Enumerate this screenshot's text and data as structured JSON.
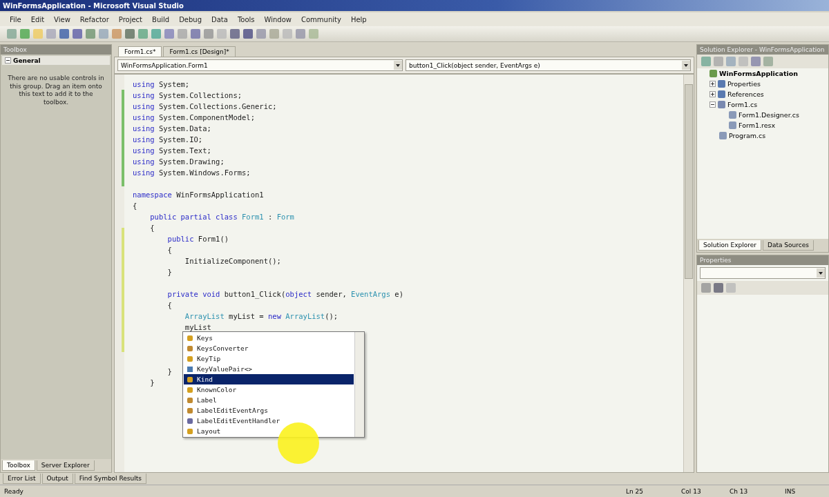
{
  "window": {
    "title": "WinFormsApplication - Microsoft Visual Studio"
  },
  "menu": [
    "File",
    "Edit",
    "View",
    "Refactor",
    "Project",
    "Build",
    "Debug",
    "Data",
    "Tools",
    "Window",
    "Community",
    "Help"
  ],
  "toolbox": {
    "title": "Toolbox",
    "group": "General",
    "message": "There are no usable controls in this group. Drag an item onto this text to add it to the toolbox.",
    "tabs": [
      {
        "label": "Toolbox",
        "selected": true
      },
      {
        "label": "Server Explorer",
        "selected": false
      }
    ]
  },
  "editor": {
    "tabs": [
      {
        "label": "Form1.cs*",
        "selected": true
      },
      {
        "label": "Form1.cs [Design]*",
        "selected": false
      }
    ],
    "type_dropdown": "WinFormsApplication.Form1",
    "member_dropdown": "button1_Click(object sender, EventArgs e)",
    "code_lines": [
      {
        "kind": "code",
        "tokens": [
          {
            "text": "using",
            "kind": "keyword"
          },
          {
            "text": " System;",
            "kind": "plain"
          }
        ]
      },
      {
        "kind": "code",
        "tokens": [
          {
            "text": "using",
            "kind": "keyword"
          },
          {
            "text": " System.Collections;",
            "kind": "plain"
          }
        ]
      },
      {
        "kind": "code",
        "tokens": [
          {
            "text": "using",
            "kind": "keyword"
          },
          {
            "text": " System.Collections.Generic;",
            "kind": "plain"
          }
        ]
      },
      {
        "kind": "code",
        "tokens": [
          {
            "text": "using",
            "kind": "keyword"
          },
          {
            "text": " System.ComponentModel;",
            "kind": "plain"
          }
        ]
      },
      {
        "kind": "code",
        "tokens": [
          {
            "text": "using",
            "kind": "keyword"
          },
          {
            "text": " System.Data;",
            "kind": "plain"
          }
        ]
      },
      {
        "kind": "code",
        "tokens": [
          {
            "text": "using",
            "kind": "keyword"
          },
          {
            "text": " System.IO;",
            "kind": "plain"
          }
        ]
      },
      {
        "kind": "code",
        "tokens": [
          {
            "text": "using",
            "kind": "keyword"
          },
          {
            "text": " System.Text;",
            "kind": "plain"
          }
        ]
      },
      {
        "kind": "code",
        "tokens": [
          {
            "text": "using",
            "kind": "keyword"
          },
          {
            "text": " System.Drawing;",
            "kind": "plain"
          }
        ]
      },
      {
        "kind": "code",
        "tokens": [
          {
            "text": "using",
            "kind": "keyword"
          },
          {
            "text": " System.Windows.Forms;",
            "kind": "plain"
          }
        ]
      },
      {
        "kind": "blank"
      },
      {
        "kind": "code",
        "tokens": [
          {
            "text": "namespace",
            "kind": "keyword"
          },
          {
            "text": " WinFormsApplication1",
            "kind": "plain"
          }
        ]
      },
      {
        "kind": "code",
        "tokens": [
          {
            "text": "{",
            "kind": "plain"
          }
        ]
      },
      {
        "kind": "code",
        "tokens": [
          {
            "text": "    public partial class",
            "kind": "keyword"
          },
          {
            "text": " Form1",
            "kind": "type"
          },
          {
            "text": " : ",
            "kind": "plain"
          },
          {
            "text": "Form",
            "kind": "type"
          }
        ]
      },
      {
        "kind": "code",
        "tokens": [
          {
            "text": "    {",
            "kind": "plain"
          }
        ]
      },
      {
        "kind": "code",
        "tokens": [
          {
            "text": "        public",
            "kind": "keyword"
          },
          {
            "text": " Form1()",
            "kind": "plain"
          }
        ]
      },
      {
        "kind": "code",
        "tokens": [
          {
            "text": "        {",
            "kind": "plain"
          }
        ]
      },
      {
        "kind": "code",
        "tokens": [
          {
            "text": "            InitializeComponent();",
            "kind": "plain"
          }
        ]
      },
      {
        "kind": "code",
        "tokens": [
          {
            "text": "        }",
            "kind": "plain"
          }
        ]
      },
      {
        "kind": "blank"
      },
      {
        "kind": "code",
        "tokens": [
          {
            "text": "        private void",
            "kind": "keyword"
          },
          {
            "text": " button1_Click(",
            "kind": "plain"
          },
          {
            "text": "object",
            "kind": "keyword"
          },
          {
            "text": " sender, ",
            "kind": "plain"
          },
          {
            "text": "EventArgs",
            "kind": "type"
          },
          {
            "text": " e)",
            "kind": "plain"
          }
        ]
      },
      {
        "kind": "code",
        "tokens": [
          {
            "text": "        {",
            "kind": "plain"
          }
        ]
      },
      {
        "kind": "code",
        "tokens": [
          {
            "text": "            ArrayList",
            "kind": "type"
          },
          {
            "text": " myList = ",
            "kind": "plain"
          },
          {
            "text": "new",
            "kind": "keyword"
          },
          {
            "text": " ArrayList",
            "kind": "type"
          },
          {
            "text": "();",
            "kind": "plain"
          }
        ]
      },
      {
        "kind": "code",
        "tokens": [
          {
            "text": "            myList",
            "kind": "plain"
          }
        ]
      },
      {
        "kind": "blank"
      },
      {
        "kind": "blank"
      },
      {
        "kind": "blank"
      },
      {
        "kind": "code",
        "tokens": [
          {
            "text": "        }",
            "kind": "plain"
          }
        ]
      },
      {
        "kind": "code",
        "tokens": [
          {
            "text": "    }",
            "kind": "plain"
          }
        ]
      }
    ],
    "completion": [
      {
        "label": "Keys",
        "kind": "enum",
        "selected": false
      },
      {
        "label": "KeysConverter",
        "kind": "class",
        "selected": false
      },
      {
        "label": "KeyTip",
        "kind": "enum",
        "selected": false
      },
      {
        "label": "KeyValuePair<>",
        "kind": "struct",
        "selected": false
      },
      {
        "label": "Kind",
        "kind": "enum",
        "selected": true
      },
      {
        "label": "KnownColor",
        "kind": "enum",
        "selected": false
      },
      {
        "label": "Label",
        "kind": "class",
        "selected": false
      },
      {
        "label": "LabelEditEventArgs",
        "kind": "class",
        "selected": false
      },
      {
        "label": "LabelEditEventHandler",
        "kind": "event",
        "selected": false
      },
      {
        "label": "Layout",
        "kind": "enum",
        "selected": false
      }
    ]
  },
  "solution_explorer": {
    "title": "Solution Explorer - WinFormsApplication",
    "tree": [
      {
        "label": "WinFormsApplication",
        "kind": "project",
        "children": [
          {
            "label": "Properties",
            "kind": "folder",
            "expanded": false
          },
          {
            "label": "References",
            "kind": "folder",
            "expanded": false
          },
          {
            "label": "Form1.cs",
            "kind": "form",
            "expanded": true,
            "children": [
              {
                "label": "Form1.Designer.cs",
                "kind": "file"
              },
              {
                "label": "Form1.resx",
                "kind": "file"
              }
            ]
          },
          {
            "label": "Program.cs",
            "kind": "file"
          }
        ]
      }
    ],
    "tabs": [
      {
        "label": "Solution Explorer",
        "selected": true
      },
      {
        "label": "Data Sources",
        "selected": false
      }
    ]
  },
  "properties": {
    "title": "Properties"
  },
  "output_tabs": [
    "Error List",
    "Output",
    "Find Symbol Results"
  ],
  "status_bar": {
    "message": "Ready",
    "line": "Ln 25",
    "column": "Col 13",
    "char": "Ch 13",
    "mode": "INS"
  }
}
